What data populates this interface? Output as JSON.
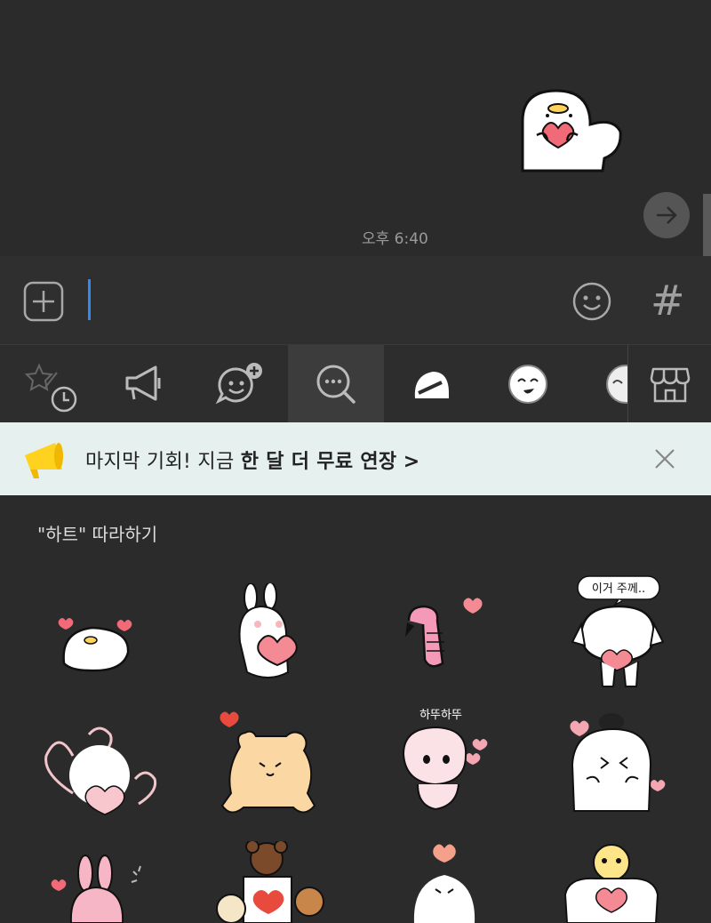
{
  "chat": {
    "timestamp": "오후 6:40",
    "sent_sticker": "ghost-holding-heart"
  },
  "input": {
    "value": "",
    "plus_icon": "plus-square-icon",
    "emoji_icon": "smiley-icon",
    "hash_label": "#"
  },
  "tabs": [
    {
      "name": "recent-favorites",
      "icon": "star-clock-icon"
    },
    {
      "name": "announcement",
      "icon": "megaphone-icon"
    },
    {
      "name": "emoticon-add",
      "icon": "chat-plus-icon"
    },
    {
      "name": "search",
      "icon": "search-chat-icon",
      "active": true
    },
    {
      "name": "sticker-pack-1",
      "icon": "ghost-pack-icon"
    },
    {
      "name": "sticker-pack-2",
      "icon": "face-pack-icon"
    },
    {
      "name": "sticker-pack-3",
      "icon": "partial-pack-icon"
    },
    {
      "name": "store",
      "icon": "store-icon"
    }
  ],
  "banner": {
    "text_plain": "마지막 기회! 지금 ",
    "text_bold": "한 달 더 무료 연장",
    "arrow": ">",
    "icon": "megaphone-yellow-icon",
    "close_icon": "close-icon"
  },
  "section": {
    "title": "\"하트\" 따라하기"
  },
  "stickers": {
    "captions": {
      "s4": "이거 주께..",
      "s7": "하뚜하뚜"
    }
  },
  "colors": {
    "background": "#2b2b2b",
    "input_bar": "#2f2f2f",
    "banner_bg": "#e6f1ef",
    "cursor": "#2e8bf0",
    "heart": "#f06a78"
  }
}
